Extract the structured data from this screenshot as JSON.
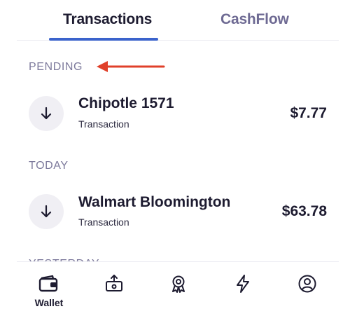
{
  "tabs": [
    {
      "label": "Transactions",
      "active": true
    },
    {
      "label": "CashFlow",
      "active": false
    }
  ],
  "sections": {
    "pending": "PENDING",
    "today": "TODAY",
    "yesterday": "YESTERDAY"
  },
  "transactions": [
    {
      "name": "Chipotle 1571",
      "subtitle": "Transaction",
      "amount": "$7.77",
      "icon": "arrow-down-icon"
    },
    {
      "name": "Walmart Bloomington",
      "subtitle": "Transaction",
      "amount": "$63.78",
      "icon": "arrow-down-icon"
    }
  ],
  "nav": [
    {
      "label": "Wallet",
      "icon": "wallet-icon",
      "active": true
    },
    {
      "icon": "cash-upload-icon"
    },
    {
      "icon": "award-ribbon-icon"
    },
    {
      "icon": "lightning-icon"
    },
    {
      "icon": "profile-icon"
    }
  ],
  "colors": {
    "accent": "#3b63cc",
    "annotation_arrow": "#e0402a",
    "text_primary": "#1d1b30",
    "text_muted": "#7d7a9c",
    "icon_bg": "#f0eff4"
  }
}
